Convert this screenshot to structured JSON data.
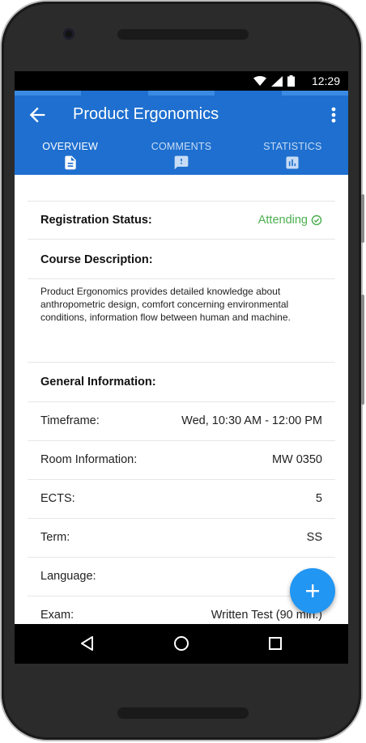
{
  "status_bar": {
    "time": "12:29",
    "icons": [
      "wifi-icon",
      "signal-icon",
      "battery-icon"
    ]
  },
  "app_bar": {
    "title": "Product Ergonomics",
    "tabs": [
      {
        "label": "OVERVIEW",
        "icon": "document-icon",
        "active": true
      },
      {
        "label": "COMMENTS",
        "icon": "comment-alert-icon",
        "active": false
      },
      {
        "label": "STATISTICS",
        "icon": "bar-chart-icon",
        "active": false
      }
    ],
    "color": "#1e6fcf"
  },
  "registration": {
    "label": "Registration Status:",
    "value": "Attending",
    "value_color": "#4caf50"
  },
  "course_description": {
    "heading": "Course Description:",
    "lines": [
      "Product Ergonomics provides detailed knowledge about",
      "anthropometric design, comfort concerning environmental",
      "conditions, information flow between human and machine."
    ]
  },
  "general_information": {
    "heading": "General Information:",
    "rows": [
      {
        "label": "Timeframe:",
        "value": "Wed, 10:30 AM - 12:00 PM"
      },
      {
        "label": "Room Information:",
        "value": "MW 0350"
      },
      {
        "label": "ECTS:",
        "value": "5"
      },
      {
        "label": "Term:",
        "value": "SS"
      },
      {
        "label": "Language:",
        "value": ""
      },
      {
        "label": "Exam:",
        "value": "Written Test (90 min.)"
      }
    ]
  },
  "fab": {
    "icon": "plus-icon",
    "color": "#2196f3"
  },
  "nav_bar": {
    "icons": [
      "back-triangle-icon",
      "home-circle-icon",
      "recents-square-icon"
    ]
  }
}
